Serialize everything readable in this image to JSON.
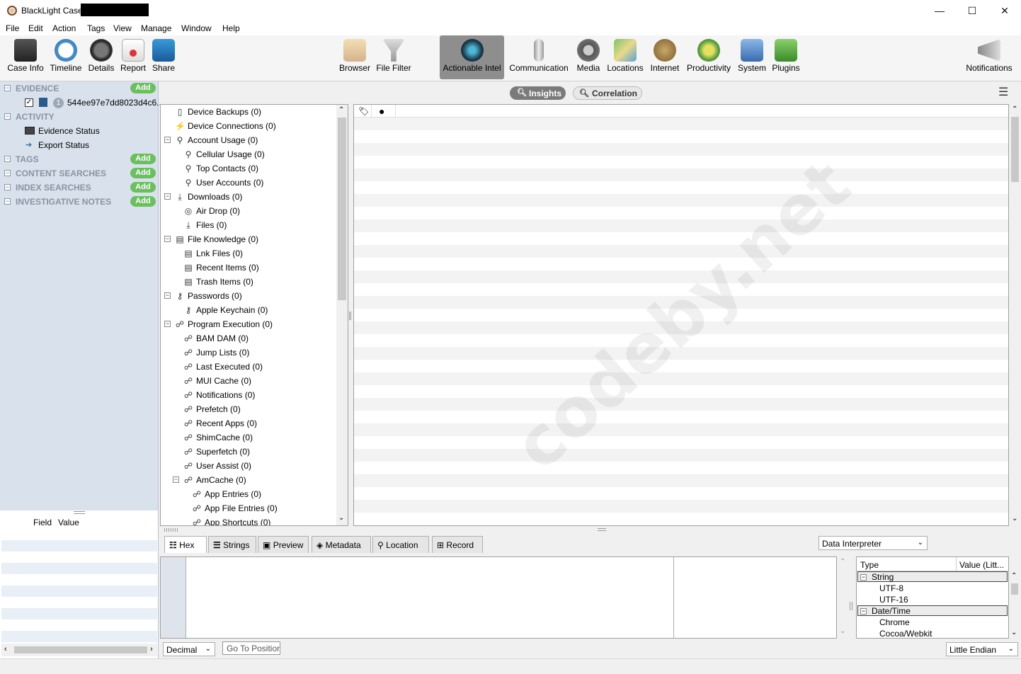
{
  "window": {
    "title": "BlackLight Case",
    "minimize": "—",
    "maximize": "☐",
    "close": "✕"
  },
  "menu": [
    "File",
    "Edit",
    "Action",
    "Tags",
    "View",
    "Manage",
    "Window",
    "Help"
  ],
  "toolbar": {
    "case_info": "Case Info",
    "timeline": "Timeline",
    "details": "Details",
    "report": "Report",
    "share": "Share",
    "browser": "Browser",
    "file_filter": "File Filter",
    "actionable_intel": "Actionable Intel",
    "communication": "Communication",
    "media": "Media",
    "locations": "Locations",
    "internet": "Internet",
    "productivity": "Productivity",
    "system": "System",
    "plugins": "Plugins",
    "notifications": "Notifications"
  },
  "sidebar": {
    "evidence": "EVIDENCE",
    "evidence_item_badge": "1",
    "evidence_item": "544ee97e7dd8023d4c6...",
    "activity": "ACTIVITY",
    "evidence_status": "Evidence Status",
    "export_status": "Export Status",
    "tags": "TAGS",
    "content_searches": "CONTENT SEARCHES",
    "index_searches": "INDEX SEARCHES",
    "investigative_notes": "INVESTIGATIVE NOTES",
    "add": "Add"
  },
  "field_panel": {
    "field": "Field",
    "value": "Value"
  },
  "view_toggle": {
    "insights": "Insights",
    "correlation": "Correlation"
  },
  "tree": [
    "Device Backups (0)",
    "Device Connections (0)",
    "Account Usage (0)",
    "Cellular Usage (0)",
    "Top Contacts (0)",
    "User Accounts (0)",
    "Downloads (0)",
    "Air Drop (0)",
    "Files (0)",
    "File Knowledge (0)",
    "Lnk Files (0)",
    "Recent Items (0)",
    "Trash Items (0)",
    "Passwords (0)",
    "Apple Keychain (0)",
    "Program Execution (0)",
    "BAM DAM (0)",
    "Jump Lists (0)",
    "Last Executed (0)",
    "MUI Cache (0)",
    "Notifications (0)",
    "Prefetch (0)",
    "Recent Apps (0)",
    "ShimCache (0)",
    "Superfetch (0)",
    "User Assist (0)",
    "AmCache (0)",
    "App Entries (0)",
    "App File Entries (0)",
    "App Shortcuts (0)"
  ],
  "watermark": "codeby.net",
  "bottom_tabs": {
    "hex": "Hex",
    "strings": "Strings",
    "preview": "Preview",
    "metadata": "Metadata",
    "location": "Location",
    "record": "Record"
  },
  "data_interpreter": {
    "select": "Data Interpreter",
    "col_type": "Type",
    "col_value": "Value (Litt...",
    "string": "String",
    "utf8": "UTF-8",
    "utf16": "UTF-16",
    "datetime": "Date/Time",
    "chrome": "Chrome",
    "cocoa": "Cocoa/Webkit"
  },
  "footer": {
    "decimal": "Decimal",
    "goto_placeholder": "Go To Position",
    "endian": "Little Endian"
  },
  "colors": {
    "sidebar_bg": "#d9e2ec",
    "add_badge": "#6bbf5f",
    "active_tool": "#8e8e8e",
    "row_stripe": "#f3f3f3"
  }
}
